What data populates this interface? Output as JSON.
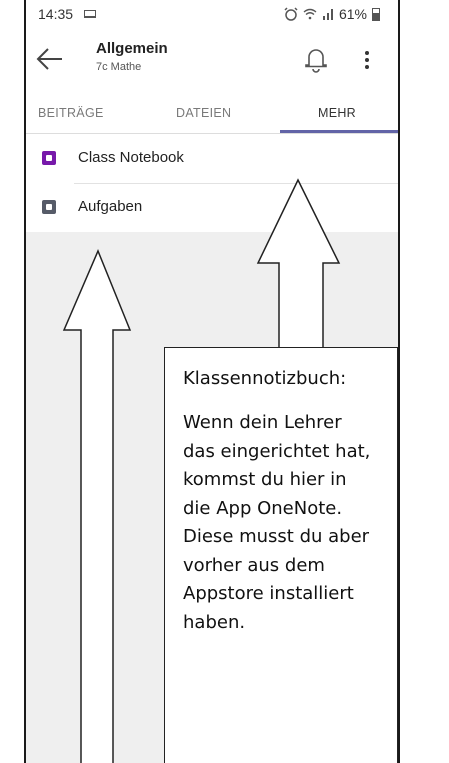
{
  "status_bar": {
    "time": "14:35",
    "battery": "61%"
  },
  "header": {
    "title": "Allgemein",
    "subtitle": "7c Mathe"
  },
  "tabs": [
    {
      "label": "BEITRÄGE"
    },
    {
      "label": "DATEIEN"
    },
    {
      "label": "MEHR"
    }
  ],
  "list": [
    {
      "label": "Class Notebook",
      "icon": "onenote-icon",
      "color": "#7719aa"
    },
    {
      "label": "Aufgaben",
      "icon": "assignments-icon",
      "color": "#565b68"
    }
  ],
  "callout": {
    "heading": "Klassennotizbuch:",
    "body": "Wenn dein Lehrer das eingerichtet hat, kommst du hier in die App OneNote. Diese musst du aber vorher aus dem Appstore installiert haben."
  },
  "accent_color": "#6264a7"
}
